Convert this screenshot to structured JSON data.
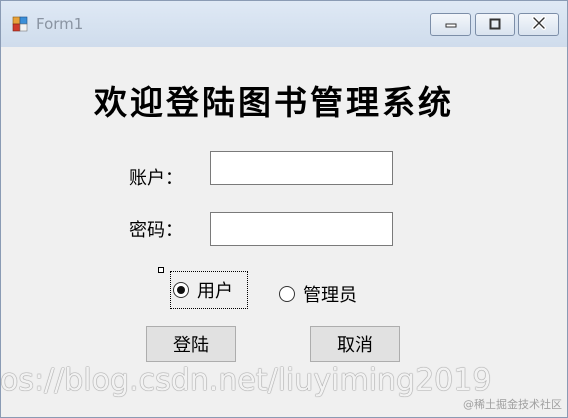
{
  "window": {
    "title": "Form1",
    "icons": {
      "app": "form-app-icon",
      "minimize": "minimize-icon",
      "maximize": "maximize-icon",
      "close": "close-icon"
    }
  },
  "form": {
    "heading": "欢迎登陆图书管理系统",
    "account_label": "账户：",
    "account_value": "",
    "password_label": "密码：",
    "password_value": "",
    "role_options": [
      {
        "label": "用户",
        "checked": true
      },
      {
        "label": "管理员",
        "checked": false
      }
    ],
    "login_label": "登陆",
    "cancel_label": "取消"
  },
  "overlay": {
    "url_watermark": "os://blog.csdn.net/liuyiming2019",
    "site_mark": "@稀土掘金技术社区"
  },
  "colors": {
    "titlebar": "#d6e2ef",
    "client_bg": "#f0f0f0",
    "button_bg": "#e1e1e1"
  }
}
